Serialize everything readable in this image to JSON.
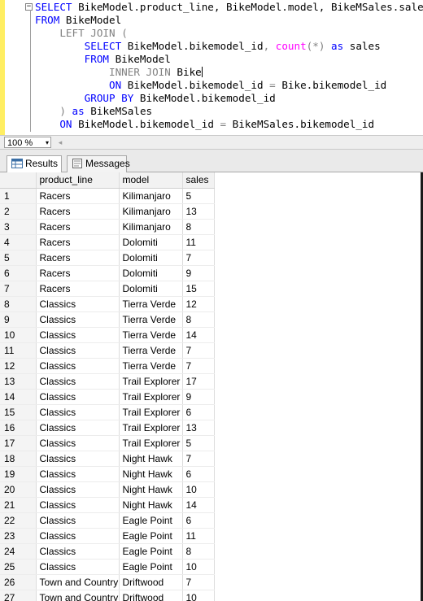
{
  "editor": {
    "lines": [
      [
        [
          "kw",
          "SELECT"
        ],
        [
          "t",
          " BikeModel.product_line, BikeModel.model, BikeMSales.sales"
        ]
      ],
      [
        [
          "kw",
          "FROM"
        ],
        [
          "t",
          " BikeModel"
        ]
      ],
      [
        [
          "t",
          "    "
        ],
        [
          "gray",
          "LEFT JOIN"
        ],
        [
          "t",
          " "
        ],
        [
          "gray",
          "("
        ]
      ],
      [
        [
          "t",
          "        "
        ],
        [
          "kw",
          "SELECT"
        ],
        [
          "t",
          " BikeModel.bikemodel_id"
        ],
        [
          "gray",
          ","
        ],
        [
          "t",
          " "
        ],
        [
          "fn",
          "count"
        ],
        [
          "gray",
          "(*)"
        ],
        [
          "t",
          " "
        ],
        [
          "kw",
          "as"
        ],
        [
          "t",
          " sales"
        ]
      ],
      [
        [
          "t",
          "        "
        ],
        [
          "kw",
          "FROM"
        ],
        [
          "t",
          " BikeModel"
        ]
      ],
      [
        [
          "t",
          "            "
        ],
        [
          "gray",
          "INNER JOIN"
        ],
        [
          "t",
          " Bike"
        ],
        [
          "caret",
          ""
        ]
      ],
      [
        [
          "t",
          "            "
        ],
        [
          "kw",
          "ON"
        ],
        [
          "t",
          " BikeModel.bikemodel_id "
        ],
        [
          "gray",
          "="
        ],
        [
          "t",
          " Bike.bikemodel_id"
        ]
      ],
      [
        [
          "t",
          "        "
        ],
        [
          "kw",
          "GROUP BY"
        ],
        [
          "t",
          " BikeModel.bikemodel_id"
        ]
      ],
      [
        [
          "t",
          "    "
        ],
        [
          "gray",
          ")"
        ],
        [
          "t",
          " "
        ],
        [
          "kw",
          "as"
        ],
        [
          "t",
          " BikeMSales"
        ]
      ],
      [
        [
          "t",
          "    "
        ],
        [
          "kw",
          "ON"
        ],
        [
          "t",
          " BikeModel.bikemodel_id "
        ],
        [
          "gray",
          "="
        ],
        [
          "t",
          " BikeMSales.bikemodel_id"
        ]
      ]
    ],
    "collapse_glyph": "−"
  },
  "zoom": {
    "value": "100 %",
    "arrow": "▾",
    "scroll_left": "◂"
  },
  "tabs": {
    "results": "Results",
    "messages": "Messages"
  },
  "grid": {
    "columns": [
      "product_line",
      "model",
      "sales"
    ],
    "rows": [
      [
        "1",
        "Racers",
        "Kilimanjaro",
        "5"
      ],
      [
        "2",
        "Racers",
        "Kilimanjaro",
        "13"
      ],
      [
        "3",
        "Racers",
        "Kilimanjaro",
        "8"
      ],
      [
        "4",
        "Racers",
        "Dolomiti",
        "11"
      ],
      [
        "5",
        "Racers",
        "Dolomiti",
        "7"
      ],
      [
        "6",
        "Racers",
        "Dolomiti",
        "9"
      ],
      [
        "7",
        "Racers",
        "Dolomiti",
        "15"
      ],
      [
        "8",
        "Classics",
        "Tierra Verde",
        "12"
      ],
      [
        "9",
        "Classics",
        "Tierra Verde",
        "8"
      ],
      [
        "10",
        "Classics",
        "Tierra Verde",
        "14"
      ],
      [
        "11",
        "Classics",
        "Tierra Verde",
        "7"
      ],
      [
        "12",
        "Classics",
        "Tierra Verde",
        "7"
      ],
      [
        "13",
        "Classics",
        "Trail Explorer",
        "17"
      ],
      [
        "14",
        "Classics",
        "Trail Explorer",
        "9"
      ],
      [
        "15",
        "Classics",
        "Trail Explorer",
        "6"
      ],
      [
        "16",
        "Classics",
        "Trail Explorer",
        "13"
      ],
      [
        "17",
        "Classics",
        "Trail Explorer",
        "5"
      ],
      [
        "18",
        "Classics",
        "Night Hawk",
        "7"
      ],
      [
        "19",
        "Classics",
        "Night Hawk",
        "6"
      ],
      [
        "20",
        "Classics",
        "Night Hawk",
        "10"
      ],
      [
        "21",
        "Classics",
        "Night Hawk",
        "14"
      ],
      [
        "22",
        "Classics",
        "Eagle Point",
        "6"
      ],
      [
        "23",
        "Classics",
        "Eagle Point",
        "11"
      ],
      [
        "24",
        "Classics",
        "Eagle Point",
        "8"
      ],
      [
        "25",
        "Classics",
        "Eagle Point",
        "10"
      ],
      [
        "26",
        "Town and Country",
        "Driftwood",
        "7"
      ],
      [
        "27",
        "Town and Country",
        "Driftwood",
        "10"
      ]
    ]
  },
  "colors": {
    "keyword": "#0000ff",
    "operator": "#808080",
    "function": "#ff00ff",
    "gutter": "#ffee62"
  }
}
